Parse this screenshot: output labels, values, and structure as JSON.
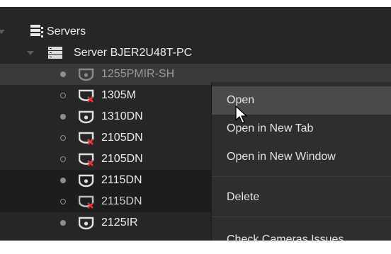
{
  "tree": {
    "root": {
      "label": "Servers",
      "icon": "servers-icon"
    },
    "server": {
      "label": "Server BJER2U48T-PC",
      "icon": "server-icon"
    },
    "cameras": [
      {
        "label": "1255PMIR-SH",
        "status": "online",
        "disabled": false,
        "selected": true
      },
      {
        "label": "1305M",
        "status": "offline",
        "disabled": true
      },
      {
        "label": "1310DN",
        "status": "online",
        "disabled": false
      },
      {
        "label": "2105DN",
        "status": "offline",
        "disabled": true
      },
      {
        "label": "2105DN",
        "status": "offline",
        "disabled": true
      },
      {
        "label": "2115DN",
        "status": "online",
        "disabled": false
      },
      {
        "label": "2115DN",
        "status": "offline",
        "disabled": true
      },
      {
        "label": "2125IR",
        "status": "online",
        "disabled": false
      }
    ]
  },
  "context_menu": {
    "items": [
      {
        "label": "Open",
        "hover": true
      },
      {
        "label": "Open in New Tab"
      },
      {
        "label": "Open in New Window"
      },
      {
        "label": "Delete"
      },
      {
        "label": "Check Cameras Issues"
      }
    ]
  },
  "colors": {
    "panel_bg": "#262626",
    "accent_red": "#e23b3b",
    "server_icon": "#d9d9d9"
  }
}
